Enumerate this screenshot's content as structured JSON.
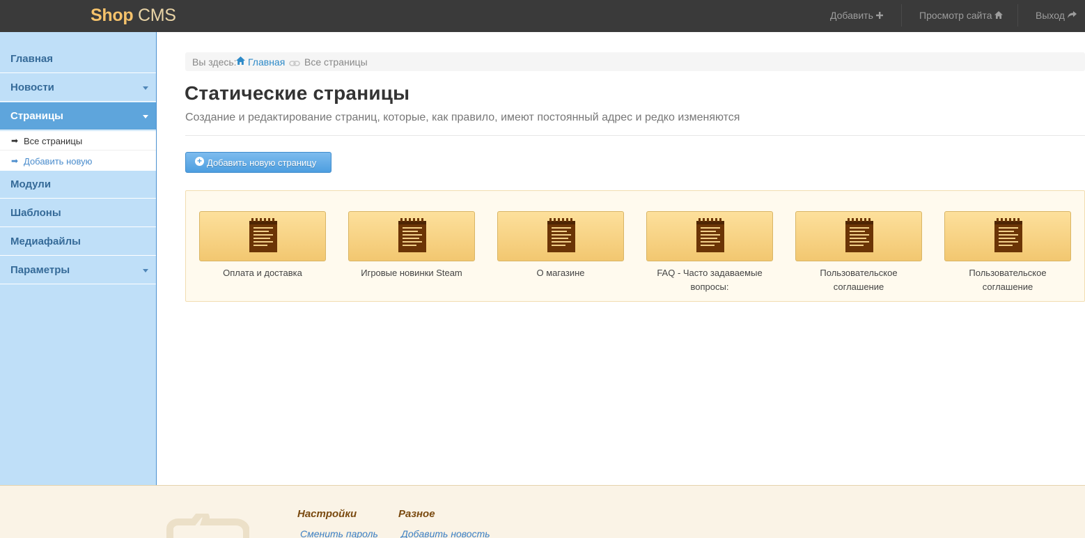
{
  "header": {
    "logo_shop": "Shop",
    "logo_cms": "CMS",
    "links": [
      {
        "label": "Добавить",
        "icon": "plus-icon"
      },
      {
        "label": "Просмотр сайта",
        "icon": "home-icon"
      },
      {
        "label": "Выход",
        "icon": "share-arrow-icon"
      }
    ]
  },
  "sidebar": {
    "items": [
      {
        "label": "Главная"
      },
      {
        "label": "Новости"
      },
      {
        "label": "Страницы"
      },
      {
        "label": "Модули"
      },
      {
        "label": "Шаблоны"
      },
      {
        "label": "Медиафайлы"
      },
      {
        "label": "Параметры"
      }
    ],
    "submenu": [
      {
        "label": "Все страницы"
      },
      {
        "label": "Добавить новую"
      }
    ]
  },
  "breadcrumb": {
    "prefix": "Вы здесь:",
    "home": "Главная",
    "current": "Все страницы"
  },
  "main": {
    "title": "Статические страницы",
    "description": "Создание и редактирование страниц, которые, как правило, имеют постоянный адрес и редко изменяются",
    "add_button": "Добавить новую страницу",
    "pages": [
      {
        "title": "Оплата и доставка"
      },
      {
        "title": "Игровые новинки Steam"
      },
      {
        "title": "О магазине"
      },
      {
        "title": "FAQ - Часто задаваемые вопросы:"
      },
      {
        "title": "Пользовательское соглашение"
      },
      {
        "title": "Пользовательское соглашение"
      }
    ]
  },
  "footer": {
    "columns": [
      {
        "title": "Настройки",
        "link": "Сменить пароль"
      },
      {
        "title": "Разное",
        "link": "Добавить новость"
      }
    ]
  },
  "colors": {
    "topbar": "#3a3a3a",
    "sidebar": "#bfdff8",
    "active": "#5ea5dc",
    "tile": "#f7d27e",
    "footer": "#faf3e6"
  }
}
